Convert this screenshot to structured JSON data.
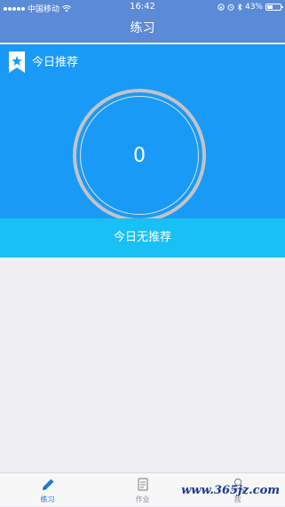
{
  "status_bar": {
    "carrier": "中国移动",
    "time": "16:42",
    "battery": "43%"
  },
  "nav": {
    "title": "练习"
  },
  "hero": {
    "title": "今日推荐",
    "count": "0"
  },
  "recommend": {
    "label": "今日无推荐"
  },
  "tabs": [
    {
      "label": "练习",
      "icon": "pencil-icon",
      "active": true
    },
    {
      "label": "作业",
      "icon": "scroll-icon",
      "active": false
    },
    {
      "label": "我",
      "icon": "person-icon",
      "active": false
    }
  ],
  "watermark": "www.365jz.com",
  "colors": {
    "nav": "#5b8ad6",
    "hero": "#1a9af7",
    "recommend": "#18c0f5",
    "tab_active": "#1a7be0"
  }
}
